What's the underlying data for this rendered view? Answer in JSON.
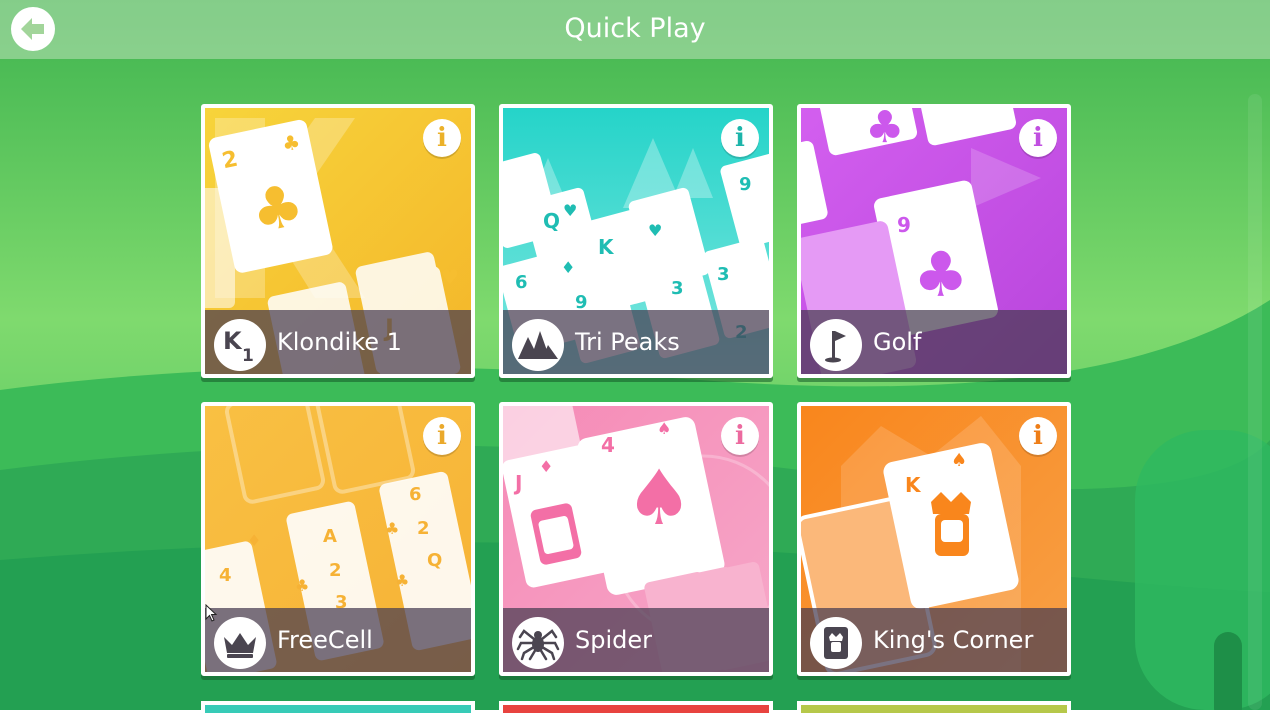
{
  "header": {
    "title": "Quick Play",
    "back_icon": "arrow-left-icon"
  },
  "games": [
    {
      "name": "Klondike 1",
      "icon": "klondike-k1-icon",
      "info_icon": "info-icon",
      "color": "#F9C935"
    },
    {
      "name": "Tri Peaks",
      "icon": "mountain-peaks-icon",
      "info_icon": "info-icon",
      "color": "#32D6CC"
    },
    {
      "name": "Golf",
      "icon": "golf-flag-icon",
      "info_icon": "info-icon",
      "color": "#D566F0"
    },
    {
      "name": "FreeCell",
      "icon": "crown-icon",
      "info_icon": "info-icon",
      "color": "#F9BF40"
    },
    {
      "name": "Spider",
      "icon": "spider-icon",
      "info_icon": "info-icon",
      "color": "#F48BB5"
    },
    {
      "name": "King's Corner",
      "icon": "king-card-icon",
      "info_icon": "info-icon",
      "color": "#F98E25"
    }
  ],
  "colors": {
    "background_green": "#5CC95A",
    "header_bar": "#A8D8A0"
  }
}
